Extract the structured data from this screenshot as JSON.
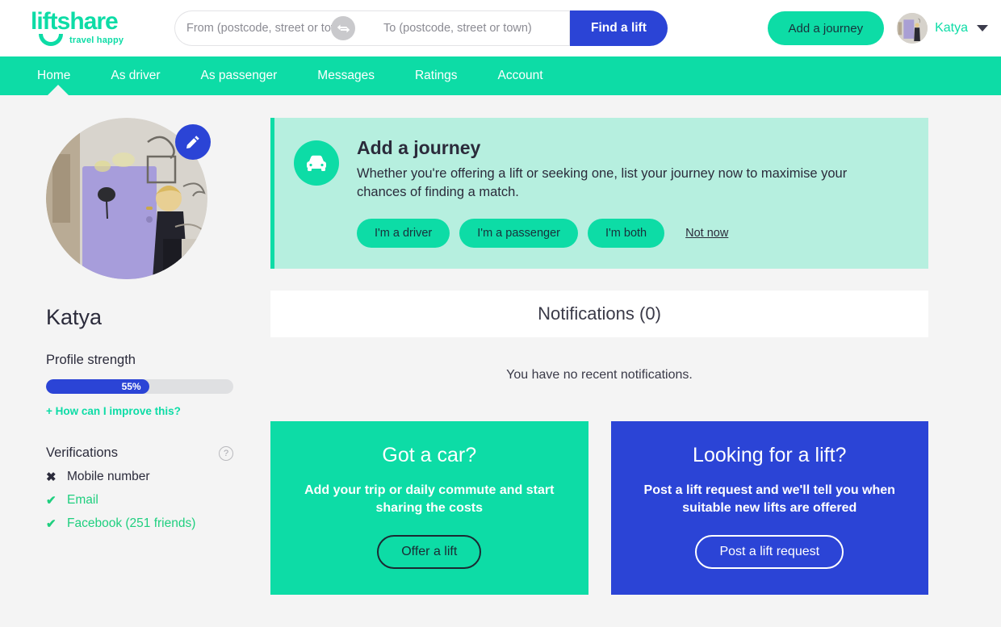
{
  "header": {
    "logo_word": "liftshare",
    "logo_tagline": "travel happy",
    "search": {
      "from_placeholder": "From (postcode, street or town)",
      "to_placeholder": "To (postcode, street or town)",
      "from_value": "",
      "to_value": "",
      "swap_icon": "swap-horizontal-icon",
      "find_label": "Find a lift"
    },
    "add_journey_label": "Add a journey",
    "user_name": "Katya",
    "avatar_icon": "user-avatar-photo",
    "chevron_icon": "chevron-down-icon"
  },
  "nav": {
    "items": [
      {
        "label": "Home",
        "active": true
      },
      {
        "label": "As driver",
        "active": false
      },
      {
        "label": "As passenger",
        "active": false
      },
      {
        "label": "Messages",
        "active": false
      },
      {
        "label": "Ratings",
        "active": false
      },
      {
        "label": "Account",
        "active": false
      }
    ]
  },
  "sidebar": {
    "edit_icon": "pencil-icon",
    "profile_name": "Katya",
    "strength_label": "Profile strength",
    "strength_percent": "55%",
    "strength_value": 55,
    "improve_link": "+ How can I improve this?",
    "verifications_title": "Verifications",
    "help_icon": "question-mark-icon",
    "verifications": [
      {
        "label": "Mobile number",
        "verified": false,
        "mark": "✖"
      },
      {
        "label": "Email",
        "verified": true,
        "mark": "✔"
      },
      {
        "label": "Facebook (251 friends)",
        "verified": true,
        "mark": "✔"
      }
    ]
  },
  "banner": {
    "icon": "car-icon",
    "title": "Add a journey",
    "body": "Whether you're offering a lift or seeking one, list your journey now to maximise your chances of finding a match.",
    "buttons": [
      "I'm a driver",
      "I'm a passenger",
      "I'm both"
    ],
    "dismiss_label": "Not now"
  },
  "notifications": {
    "title": "Notifications (0)",
    "count": 0,
    "empty_text": "You have no recent notifications."
  },
  "promos": [
    {
      "title": "Got a car?",
      "body": "Add your trip or daily commute and start sharing the costs",
      "button": "Offer a lift",
      "color": "#0ddca6"
    },
    {
      "title": "Looking for a lift?",
      "body": "Post a lift request and we'll tell you when suitable new lifts are offered",
      "button": "Post a lift request",
      "color": "#2b44d6"
    }
  ]
}
